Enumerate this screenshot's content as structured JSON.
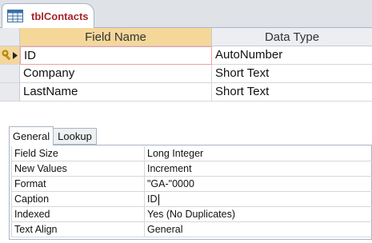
{
  "document_tab": {
    "icon": "table-icon",
    "title": "tblContacts"
  },
  "grid": {
    "columns": {
      "field_name": "Field Name",
      "data_type": "Data Type"
    },
    "rows": [
      {
        "field_name": "ID",
        "data_type": "AutoNumber",
        "primary_key": true,
        "current": true
      },
      {
        "field_name": "Company",
        "data_type": "Short Text"
      },
      {
        "field_name": "LastName",
        "data_type": "Short Text"
      }
    ]
  },
  "field_properties": {
    "tabs": [
      "General",
      "Lookup"
    ],
    "active_tab": "General",
    "rows": [
      {
        "label": "Field Size",
        "value": "Long Integer"
      },
      {
        "label": "New Values",
        "value": "Increment"
      },
      {
        "label": "Format",
        "value": "\"GA-\"0000"
      },
      {
        "label": "Caption",
        "value": "ID"
      },
      {
        "label": "Indexed",
        "value": "Yes (No Duplicates)"
      },
      {
        "label": "Text Align",
        "value": "General"
      }
    ]
  },
  "colors": {
    "selected_header": "#f5d79a",
    "tab_title": "#a4262c",
    "key_icon": "#d4a017"
  }
}
